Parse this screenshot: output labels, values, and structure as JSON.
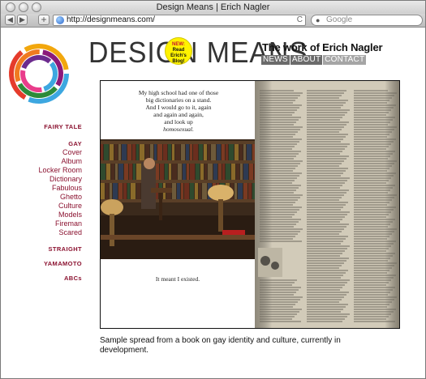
{
  "window": {
    "title": "Design Means | Erich Nagler"
  },
  "toolbar": {
    "url": "http://designmeans.com/",
    "search_placeholder": "Google",
    "back_glyph": "◀",
    "forward_glyph": "▶",
    "add_glyph": "+",
    "reload_glyph": "C"
  },
  "header": {
    "brand": "DESIGN MEANS",
    "blog_new": "NEW:",
    "blog_text": "Read Erich's Blog!",
    "tagline": "The work of Erich Nagler",
    "nav": [
      "NEWS",
      "ABOUT",
      "CONTACT"
    ]
  },
  "badge": {
    "words": [
      "MAGAZINES",
      "GRAPHICS",
      "BOOKS",
      "OBJECTS",
      "TYPOGRAPHY",
      "WRITING",
      "SPACES",
      "ILLUSTRATION"
    ],
    "colors": [
      "#3da7e0",
      "#e53b2b",
      "#f2a70d",
      "#2c8b3a",
      "#f07a20",
      "#8b1a7a",
      "#e93d8b",
      "#6c2b8e"
    ]
  },
  "sidenav": {
    "sections": [
      {
        "label": "FAIRY TALE",
        "items": []
      },
      {
        "label": "GAY",
        "items": [
          "Cover",
          "Album",
          "Locker Room",
          "Dictionary",
          "Fabulous",
          "Ghetto",
          "Culture",
          "Models",
          "Fireman",
          "Scared"
        ]
      },
      {
        "label": "STRAIGHT",
        "items": []
      },
      {
        "label": "YAMAMOTO",
        "items": []
      },
      {
        "label": "ABCs",
        "items": []
      }
    ]
  },
  "spread": {
    "quote_lines": [
      "My high school had one of those",
      "big dictionaries on a stand.",
      "And I would go to it, again",
      "and again and again,",
      "and look up"
    ],
    "quote_word": "homosexual.",
    "bottom_text": "It meant I existed."
  },
  "caption": "Sample spread from a book on gay identity and culture, currently in development."
}
